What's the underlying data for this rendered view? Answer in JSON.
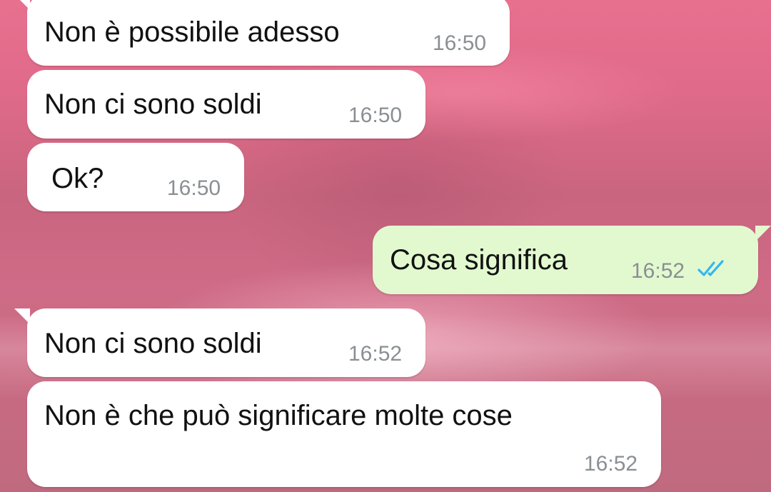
{
  "chat": {
    "messages": [
      {
        "direction": "incoming",
        "text": "Non è possibile adesso",
        "time": "16:50"
      },
      {
        "direction": "incoming",
        "text": "Non ci sono soldi",
        "time": "16:50"
      },
      {
        "direction": "incoming",
        "text": "Ok?",
        "time": "16:50"
      },
      {
        "direction": "outgoing",
        "text": "Cosa significa",
        "time": "16:52",
        "status": "read",
        "status_icon": "double-check-icon"
      },
      {
        "direction": "incoming",
        "text": "Non ci sono soldi",
        "time": "16:52"
      },
      {
        "direction": "incoming",
        "text": "Non è che può significare molte cose",
        "time": "16:52"
      }
    ]
  },
  "colors": {
    "incoming_bubble": "#ffffff",
    "outgoing_bubble": "#e2f9cf",
    "timestamp": "#8a8f93",
    "read_ticks": "#34b7f1",
    "wallpaper": "#d66b86"
  }
}
